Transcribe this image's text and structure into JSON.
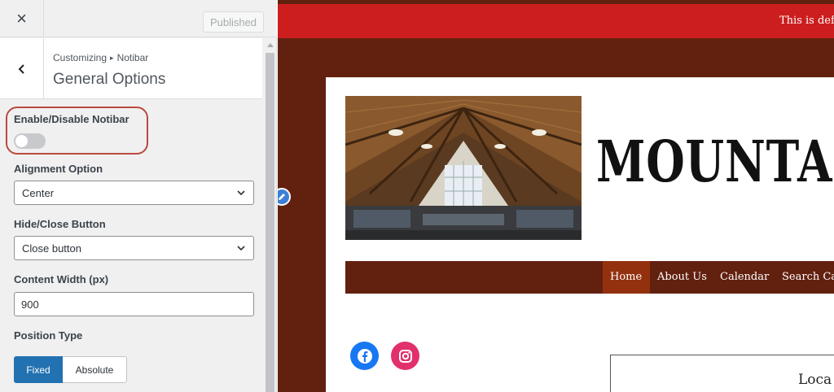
{
  "topbar": {
    "close_glyph": "×",
    "publish_label": "Published"
  },
  "section": {
    "breadcrumb_root": "Customizing",
    "breadcrumb_sep": "▸",
    "breadcrumb_panel": "Notibar",
    "title": "General Options"
  },
  "controls": {
    "enable_label": "Enable/Disable Notibar",
    "enable_on": false,
    "align_label": "Alignment Option",
    "align_value": "Center",
    "hide_label": "Hide/Close Button",
    "hide_value": "Close button",
    "width_label": "Content Width (px)",
    "width_value": "900",
    "position_label": "Position Type",
    "position_options": [
      "Fixed",
      "Absolute"
    ],
    "position_selected": "Fixed"
  },
  "preview": {
    "notibar_text": "This is def",
    "site_title": "MOUNTAIN",
    "nav": [
      "Home",
      "About Us",
      "Calendar",
      "Search Ca"
    ],
    "nav_active": "Home",
    "location_heading": "Loca",
    "colors": {
      "notibar": "#cc1e1e",
      "site_bg": "#62200f",
      "nav_active": "#93310f",
      "accent": "#2271b1"
    }
  }
}
